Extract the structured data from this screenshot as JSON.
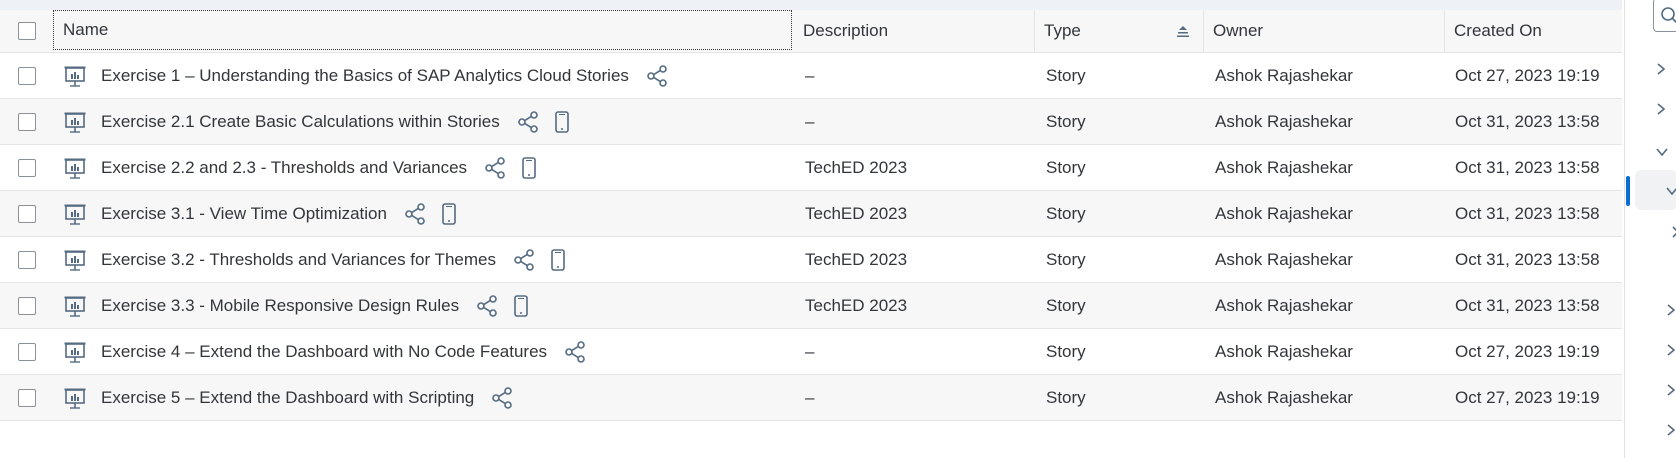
{
  "columns": {
    "name": "Name",
    "description": "Description",
    "type": "Type",
    "owner": "Owner",
    "created_on": "Created On"
  },
  "rows": [
    {
      "name": "Exercise 1 – Understanding the Basics of SAP Analytics Cloud Stories",
      "description": "–",
      "type": "Story",
      "owner": "Ashok Rajashekar",
      "created_on": "Oct 27, 2023 19:19",
      "mobile": false
    },
    {
      "name": "Exercise 2.1 Create Basic Calculations within Stories",
      "description": "–",
      "type": "Story",
      "owner": "Ashok Rajashekar",
      "created_on": "Oct 31, 2023 13:58",
      "mobile": true
    },
    {
      "name": "Exercise 2.2 and 2.3 - Thresholds and Variances",
      "description": "TechED 2023",
      "type": "Story",
      "owner": "Ashok Rajashekar",
      "created_on": "Oct 31, 2023 13:58",
      "mobile": true
    },
    {
      "name": "Exercise 3.1 - View Time Optimization",
      "description": "TechED 2023",
      "type": "Story",
      "owner": "Ashok Rajashekar",
      "created_on": "Oct 31, 2023 13:58",
      "mobile": true
    },
    {
      "name": "Exercise 3.2 - Thresholds and Variances for Themes",
      "description": "TechED 2023",
      "type": "Story",
      "owner": "Ashok Rajashekar",
      "created_on": "Oct 31, 2023 13:58",
      "mobile": true
    },
    {
      "name": "Exercise 3.3 - Mobile Responsive Design Rules",
      "description": "TechED 2023",
      "type": "Story",
      "owner": "Ashok Rajashekar",
      "created_on": "Oct 31, 2023 13:58",
      "mobile": true
    },
    {
      "name": "Exercise 4 – Extend the Dashboard with No Code Features",
      "description": "–",
      "type": "Story",
      "owner": "Ashok Rajashekar",
      "created_on": "Oct 27, 2023 19:19",
      "mobile": false
    },
    {
      "name": "Exercise 5 – Extend the Dashboard with Scripting",
      "description": "–",
      "type": "Story",
      "owner": "Ashok Rajashekar",
      "created_on": "Oct 27, 2023 19:19",
      "mobile": false
    }
  ],
  "icons": {
    "story": "story-icon",
    "share": "share-icon",
    "mobile": "mobile-icon",
    "sort": "sort-ascending-icon",
    "chevron_right": "chevron-right-icon",
    "chevron_down": "chevron-down-icon",
    "search": "search-icon"
  },
  "colors": {
    "accent": "#0a6ed1",
    "icon": "#556b82",
    "text": "#32363a",
    "row_alt": "#f7f7f7",
    "border": "#e5e5e5"
  }
}
